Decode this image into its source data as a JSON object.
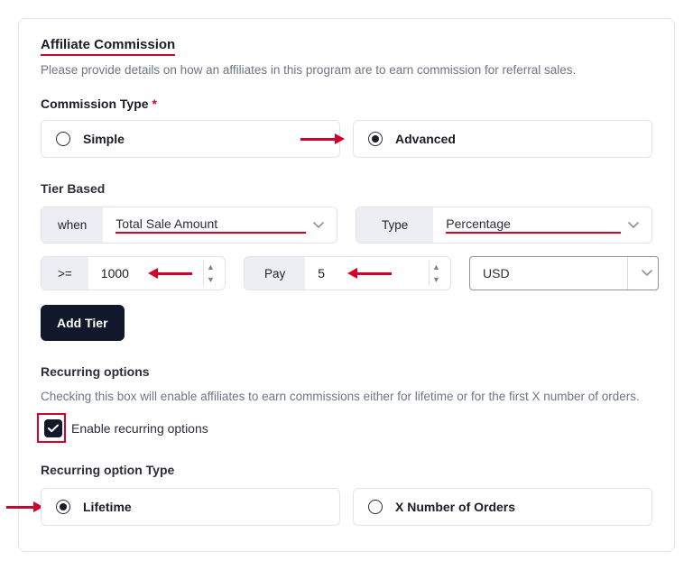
{
  "section": {
    "title": "Affiliate Commission",
    "help": "Please provide details on how an affiliates in this program are to earn commission for referral sales."
  },
  "commissionType": {
    "label": "Commission Type",
    "required": "*",
    "options": {
      "simple": "Simple",
      "advanced": "Advanced"
    },
    "selected": "advanced"
  },
  "tierBased": {
    "label": "Tier Based",
    "whenPrefix": "when",
    "whenValue": "Total Sale Amount",
    "typePrefix": "Type",
    "typeValue": "Percentage",
    "opPrefix": ">=",
    "opValue": "1000",
    "payPrefix": "Pay",
    "payValue": "5",
    "currency": "USD",
    "addTier": "Add Tier"
  },
  "recurring": {
    "heading": "Recurring options",
    "help": "Checking this box will enable affiliates to earn commissions either for lifetime or for the first X number of orders.",
    "enableLabel": "Enable recurring options",
    "typeHeading": "Recurring option Type",
    "lifetime": "Lifetime",
    "xorders": "X Number of Orders"
  }
}
